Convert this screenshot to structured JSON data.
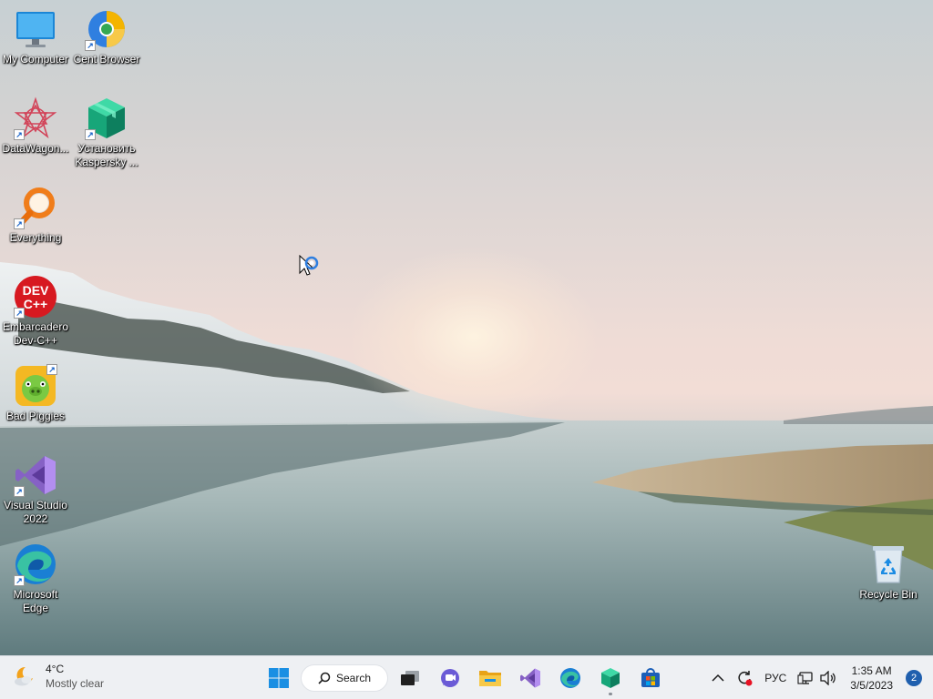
{
  "desktop": {
    "icons": [
      {
        "label": "My Computer",
        "icon": "monitor-icon",
        "shortcut": false
      },
      {
        "label": "Cent Browser",
        "icon": "cent-browser-icon",
        "shortcut": true
      },
      {
        "label": "DataWagon...",
        "icon": "datawagon-icon",
        "shortcut": true
      },
      {
        "label": "Установить Kaspersky ...",
        "icon": "kaspersky-box-icon",
        "shortcut": true
      },
      {
        "label": "Everything",
        "icon": "everything-search-icon",
        "shortcut": true
      },
      {
        "label": "Embarcadero Dev-C++",
        "icon": "dev-cpp-icon",
        "shortcut": true,
        "logo_text": "DEV C++"
      },
      {
        "label": "Bad Piggies",
        "icon": "bad-piggies-icon",
        "shortcut": true
      },
      {
        "label": "Visual Studio 2022",
        "icon": "visual-studio-icon",
        "shortcut": true
      },
      {
        "label": "Microsoft Edge",
        "icon": "edge-icon",
        "shortcut": true
      },
      {
        "label": "Recycle Bin",
        "icon": "recycle-bin-icon",
        "shortcut": false
      }
    ]
  },
  "taskbar": {
    "weather": {
      "temp": "4°C",
      "condition": "Mostly clear",
      "icon": "moon-cloud-icon"
    },
    "search_label": "Search",
    "pinned": [
      {
        "name": "start",
        "icon": "windows-start-icon"
      },
      {
        "name": "task-view",
        "icon": "task-view-icon"
      },
      {
        "name": "chat",
        "icon": "teams-chat-icon"
      },
      {
        "name": "file-explorer",
        "icon": "folder-icon"
      },
      {
        "name": "visual-studio",
        "icon": "visual-studio-icon"
      },
      {
        "name": "edge",
        "icon": "edge-icon"
      },
      {
        "name": "kaspersky",
        "icon": "kaspersky-box-icon",
        "running": true
      },
      {
        "name": "store",
        "icon": "store-icon"
      }
    ],
    "tray": {
      "language": "РУС",
      "time": "1:35 AM",
      "date": "3/5/2023",
      "notification_count": "2"
    }
  },
  "colors": {
    "taskbar_bg": "#eef0f3",
    "accent": "#1f5fae",
    "start_blue": "#1a8fe3"
  }
}
